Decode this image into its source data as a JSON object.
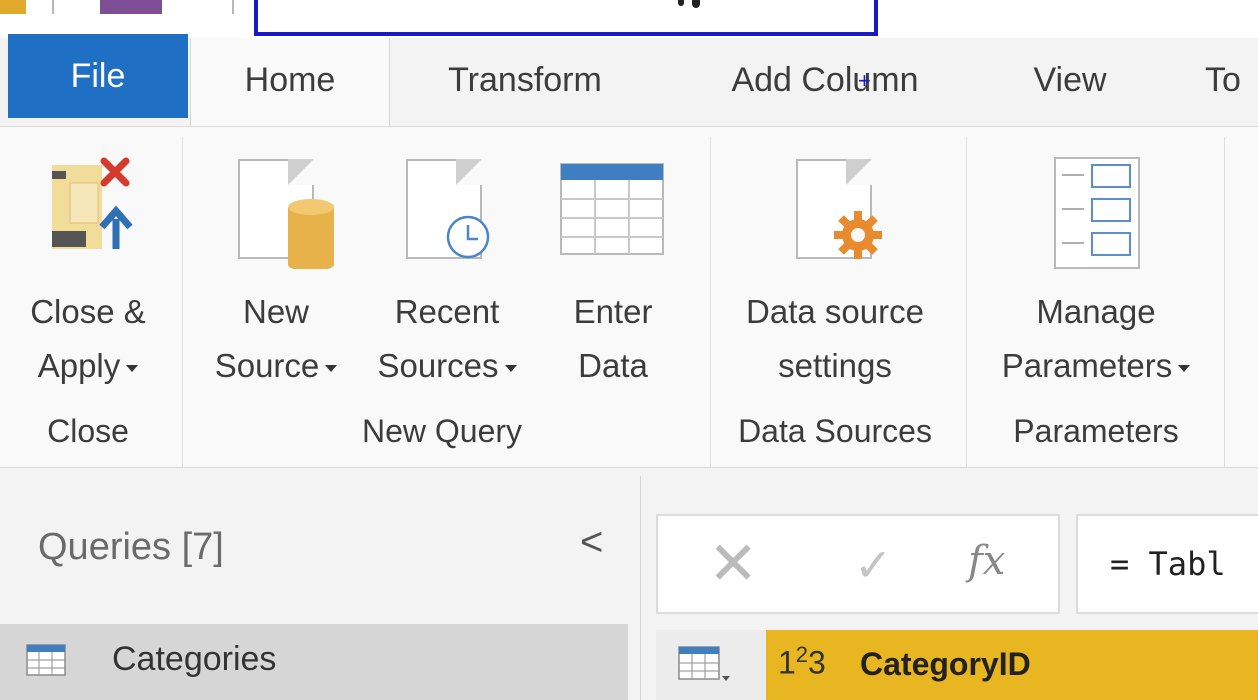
{
  "tabs": {
    "file": "File",
    "home": "Home",
    "transform": "Transform",
    "add_column": "Add Column",
    "view": "View",
    "to": "To"
  },
  "ribbon": {
    "close_group": {
      "close_apply_line1": "Close &",
      "close_apply_line2": "Apply",
      "label": "Close"
    },
    "new_query_group": {
      "new_source_line1": "New",
      "new_source_line2": "Source",
      "recent_sources_line1": "Recent",
      "recent_sources_line2": "Sources",
      "enter_data_line1": "Enter",
      "enter_data_line2": "Data",
      "label": "New Query"
    },
    "data_sources_group": {
      "settings_line1": "Data source",
      "settings_line2": "settings",
      "label": "Data Sources"
    },
    "parameters_group": {
      "manage_line1": "Manage",
      "manage_line2": "Parameters",
      "label": "Parameters"
    }
  },
  "queries_pane": {
    "title": "Queries [7]",
    "collapse_glyph": "<",
    "items": [
      {
        "label": "Categories"
      }
    ]
  },
  "formula_bar": {
    "cancel_glyph": "✕",
    "commit_glyph": "✓",
    "fx_glyph": "fx",
    "value": "= Tabl"
  },
  "grid": {
    "column_type": "1²3",
    "column_type_base": "1",
    "column_type_sup": "2",
    "column_type_sub": "3",
    "column_name": "CategoryID"
  },
  "colors": {
    "file_tab": "#1f6fc5",
    "column_header": "#e8b620",
    "selected_query": "#d6d6d6",
    "title_highlight_box": "#1a1ac4"
  }
}
